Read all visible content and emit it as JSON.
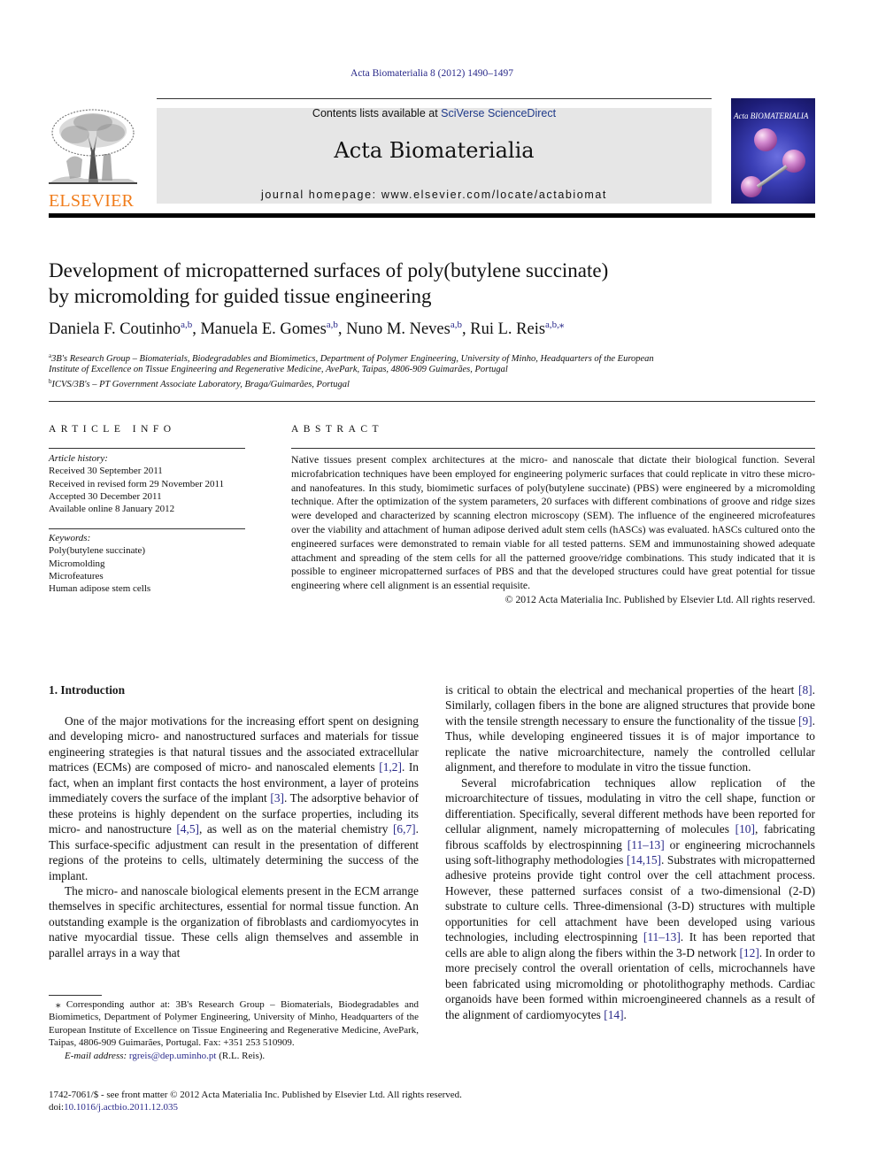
{
  "header": {
    "journal_ref": "Acta Biomaterialia 8 (2012) 1490–1497",
    "publisher_logo_text": "ELSEVIER",
    "contents_prefix": "Contents lists available at ",
    "contents_link": "SciVerse ScienceDirect",
    "journal_title": "Acta Biomaterialia",
    "homepage_label": "journal homepage: ",
    "homepage_url": "www.elsevier.com/locate/actabiomat",
    "cover_title": "Acta BIOMATERIALIA",
    "colors": {
      "elsevier_orange": "#f07c1a",
      "link_blue": "#2a2a8a",
      "header_gray": "#e6e6e6"
    }
  },
  "article": {
    "title_line1": "Development of micropatterned surfaces of poly(butylene succinate)",
    "title_line2": "by micromolding for guided tissue engineering",
    "authors": [
      {
        "name": "Daniela F. Coutinho",
        "sup": "a,b",
        "sep": ", "
      },
      {
        "name": "Manuela E. Gomes",
        "sup": "a,b",
        "sep": ", "
      },
      {
        "name": "Nuno M. Neves",
        "sup": "a,b",
        "sep": ", "
      },
      {
        "name": "Rui L. Reis",
        "sup": "a,b,⁎",
        "sep": ""
      }
    ],
    "affiliations": [
      {
        "mark": "a",
        "line1": "3B's Research Group – Biomaterials, Biodegradables and Biomimetics, Department of Polymer Engineering, University of Minho, Headquarters of the European",
        "line2": "Institute of Excellence on Tissue Engineering and Regenerative Medicine, AvePark, Taipas, 4806-909 Guimarães, Portugal"
      },
      {
        "mark": "b",
        "line1": "ICVS/3B's – PT Government Associate Laboratory, Braga/Guimarães, Portugal"
      }
    ]
  },
  "article_info": {
    "heading": "ARTICLE INFO",
    "history_label": "Article history:",
    "history": [
      "Received 30 September 2011",
      "Received in revised form 29 November 2011",
      "Accepted 30 December 2011",
      "Available online 8 January 2012"
    ],
    "keywords_label": "Keywords:",
    "keywords": [
      "Poly(butylene succinate)",
      "Micromolding",
      "Microfeatures",
      "Human adipose stem cells"
    ]
  },
  "abstract": {
    "heading": "ABSTRACT",
    "text": "Native tissues present complex architectures at the micro- and nanoscale that dictate their biological function. Several microfabrication techniques have been employed for engineering polymeric surfaces that could replicate in vitro these micro- and nanofeatures. In this study, biomimetic surfaces of poly(butylene succinate) (PBS) were engineered by a micromolding technique. After the optimization of the system parameters, 20 surfaces with different combinations of groove and ridge sizes were developed and characterized by scanning electron microscopy (SEM). The influence of the engineered microfeatures over the viability and attachment of human adipose derived adult stem cells (hASCs) was evaluated. hASCs cultured onto the engineered surfaces were demonstrated to remain viable for all tested patterns. SEM and immunostaining showed adequate attachment and spreading of the stem cells for all the patterned groove/ridge combinations. This study indicated that it is possible to engineer micropatterned surfaces of PBS and that the developed structures could have great potential for tissue engineering where cell alignment is an essential requisite.",
    "copyright": "© 2012 Acta Materialia Inc. Published by Elsevier Ltd. All rights reserved."
  },
  "introduction": {
    "heading": "1. Introduction",
    "left_paragraphs": [
      [
        {
          "t": "One of the major motivations for the increasing effort spent on designing and developing micro- and nanostructured surfaces and materials for tissue engineering strategies is that natural tissues and the associated extracellular matrices (ECMs) are composed of micro- and nanoscaled elements "
        },
        {
          "ref": "[1,2]"
        },
        {
          "t": ". In fact, when an implant first contacts the host environment, a layer of proteins immediately covers the surface of the implant "
        },
        {
          "ref": "[3]"
        },
        {
          "t": ". The adsorptive behavior of these proteins is highly dependent on the surface properties, including its micro- and nanostructure "
        },
        {
          "ref": "[4,5]"
        },
        {
          "t": ", as well as on the material chemistry "
        },
        {
          "ref": "[6,7]"
        },
        {
          "t": ". This surface-specific adjustment can result in the presentation of different regions of the proteins to cells, ultimately determining the success of the implant."
        }
      ],
      [
        {
          "t": "The micro- and nanoscale biological elements present in the ECM arrange themselves in specific architectures, essential for normal tissue function. An outstanding example is the organization of fibroblasts and cardiomyocytes in native myocardial tissue. These cells align themselves and assemble in parallel arrays in a way that"
        }
      ]
    ],
    "right_paragraphs": [
      [
        {
          "t": "is critical to obtain the electrical and mechanical properties of the heart "
        },
        {
          "ref": "[8]"
        },
        {
          "t": ". Similarly, collagen fibers in the bone are aligned structures that provide bone with the tensile strength necessary to ensure the functionality of the tissue "
        },
        {
          "ref": "[9]"
        },
        {
          "t": ". Thus, while developing engineered tissues it is of major importance to replicate the native microarchitecture, namely the controlled cellular alignment, and therefore to modulate in vitro the tissue function."
        }
      ],
      [
        {
          "t": "Several microfabrication techniques allow replication of the microarchitecture of tissues, modulating in vitro the cell shape, function or differentiation. Specifically, several different methods have been reported for cellular alignment, namely micropatterning of molecules "
        },
        {
          "ref": "[10]"
        },
        {
          "t": ", fabricating fibrous scaffolds by electrospinning "
        },
        {
          "ref": "[11–13]"
        },
        {
          "t": " or engineering microchannels using soft-lithography methodologies "
        },
        {
          "ref": "[14,15]"
        },
        {
          "t": ". Substrates with micropatterned adhesive proteins provide tight control over the cell attachment process. However, these patterned surfaces consist of a two-dimensional (2-D) substrate to culture cells. Three-dimensional (3-D) structures with multiple opportunities for cell attachment have been developed using various technologies, including electrospinning "
        },
        {
          "ref": "[11–13]"
        },
        {
          "t": ". It has been reported that cells are able to align along the fibers within the 3-D network "
        },
        {
          "ref": "[12]"
        },
        {
          "t": ". In order to more precisely control the overall orientation of cells, microchannels have been fabricated using micromolding or photolithography methods. Cardiac organoids have been formed within microengineered channels as a result of the alignment of cardiomyocytes "
        },
        {
          "ref": "[14]"
        },
        {
          "t": "."
        }
      ]
    ]
  },
  "footnote": {
    "corresponding": "⁎ Corresponding author at: 3B's Research Group – Biomaterials, Biodegradables and Biomimetics, Department of Polymer Engineering, University of Minho, Headquarters of the European Institute of Excellence on Tissue Engineering and Regenerative Medicine, AvePark, Taipas, 4806-909 Guimarães, Portugal. Fax: +351 253 510909.",
    "email_label": "E-mail address: ",
    "email": "rgreis@dep.uminho.pt",
    "email_suffix": " (R.L. Reis)."
  },
  "bottom": {
    "issn_line": "1742-7061/$ - see front matter © 2012 Acta Materialia Inc. Published by Elsevier Ltd. All rights reserved.",
    "doi_label": "doi:",
    "doi": "10.1016/j.actbio.2011.12.035"
  }
}
